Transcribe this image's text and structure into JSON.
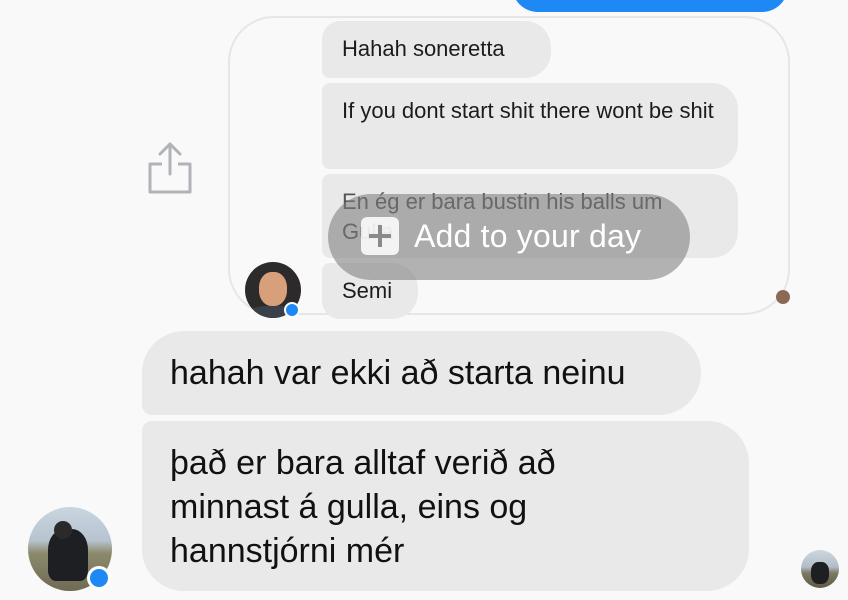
{
  "conversation": {
    "quoted_messages": [
      {
        "text": "Hahah soneretta"
      },
      {
        "text": "If you dont start shit there wont be shit"
      },
      {
        "text": "En ég er bara bustin his balls um Gulla"
      },
      {
        "text": "Semi"
      }
    ],
    "messages": [
      {
        "text": "hahah var ekki að starta neinu"
      },
      {
        "text": "það er bara alltaf verið að minnast á gulla, eins og hannstjórni mér"
      }
    ]
  },
  "story_overlay": {
    "label": "Add to your day",
    "icon": "plus-icon"
  },
  "icons": {
    "share": "share-icon",
    "messenger_badge": "messenger-badge-icon"
  },
  "colors": {
    "outgoing_bubble": "#1e88f5",
    "incoming_bubble": "#e9e9ea",
    "background": "#f9f9fa",
    "badge": "#1e88f5"
  }
}
